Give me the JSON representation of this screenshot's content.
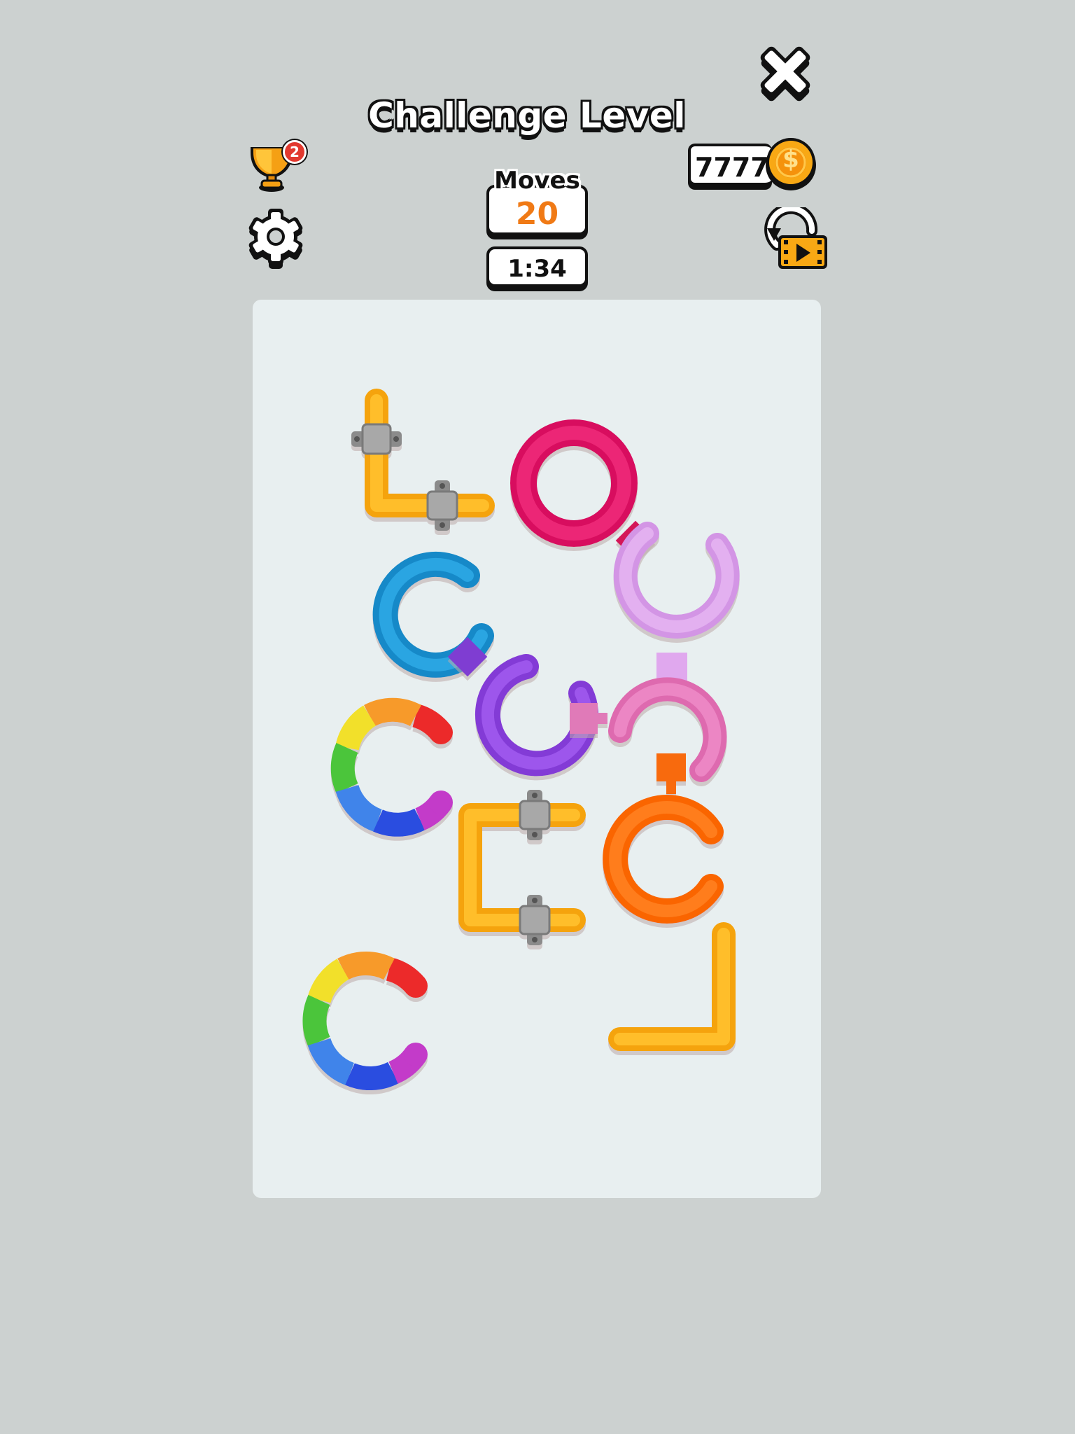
{
  "header": {
    "title": "Challenge Level",
    "trophy_badge": "2",
    "moves_label": "Moves",
    "moves_value": "20",
    "timer": "1:34",
    "coins": "7777",
    "coin_symbol": "$"
  },
  "icons": {
    "close": "close-icon",
    "trophy": "trophy-icon",
    "settings": "gear-icon",
    "coin": "coin-icon",
    "replay": "replay-video-icon"
  },
  "board": {
    "pieces": [
      {
        "name": "yellow-elbow-pipe",
        "shape": "elbow",
        "color": "#ffad12",
        "clamps": 2
      },
      {
        "name": "magenta-ring-pipe",
        "shape": "ring",
        "color": "#e01566"
      },
      {
        "name": "lilac-arc-pipe",
        "shape": "arc",
        "color": "#dca0ea"
      },
      {
        "name": "blue-arc-pipe",
        "shape": "arc",
        "color": "#1e95d4"
      },
      {
        "name": "purple-arc-pipe",
        "shape": "arc",
        "color": "#8e44e0"
      },
      {
        "name": "pink-arc-pipe",
        "shape": "arc",
        "color": "#e475b8"
      },
      {
        "name": "rainbow-arc-pipe-1",
        "shape": "arc",
        "color": "rainbow"
      },
      {
        "name": "yellow-bracket-pipe",
        "shape": "bracket",
        "color": "#ffad12",
        "clamps": 2
      },
      {
        "name": "orange-arc-pipe",
        "shape": "arc",
        "color": "#ff6e08"
      },
      {
        "name": "rainbow-arc-pipe-2",
        "shape": "arc",
        "color": "rainbow"
      },
      {
        "name": "yellow-l-pipe",
        "shape": "elbow",
        "color": "#ffad12"
      }
    ]
  },
  "colors": {
    "background": "#ccd1d0",
    "board": "#e8eff0",
    "moves_number": "#f07a16",
    "coin": "#f8a814"
  }
}
